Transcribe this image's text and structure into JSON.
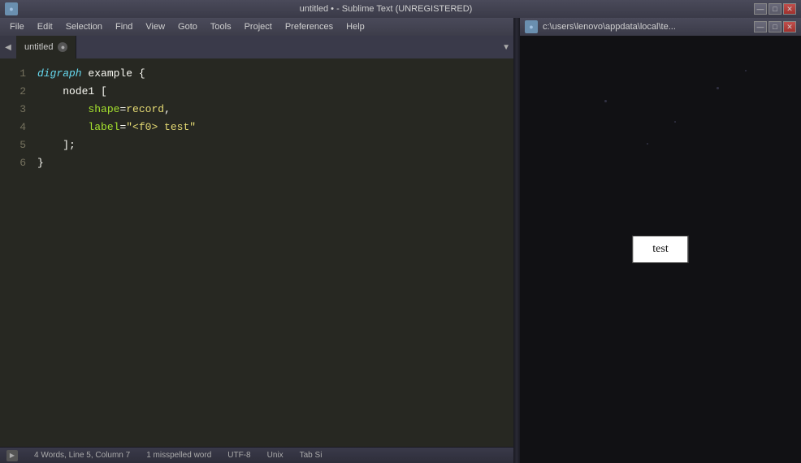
{
  "window": {
    "title": "untitled • - Sublime Text (UNREGISTERED)",
    "icon": "ST",
    "preview_title": "c:\\users\\lenovo\\appdata\\local\\te..."
  },
  "title_buttons": {
    "minimize": "—",
    "maximize": "□",
    "close": "✕"
  },
  "menu": {
    "items": [
      "File",
      "Edit",
      "Selection",
      "Find",
      "View",
      "Goto",
      "Tools",
      "Project",
      "Preferences",
      "Help"
    ]
  },
  "tab": {
    "name": "untitled",
    "close_btn": "●"
  },
  "code": {
    "lines": [
      {
        "num": "1",
        "content": "digraph example {"
      },
      {
        "num": "2",
        "content": "    node1 ["
      },
      {
        "num": "3",
        "content": "        shape=record,"
      },
      {
        "num": "4",
        "content": "        label=\"<f0> test\""
      },
      {
        "num": "5",
        "content": "    ];"
      },
      {
        "num": "6",
        "content": "}"
      }
    ]
  },
  "status_bar": {
    "words": "4 Words, Line 5, Column 7",
    "spelling": "1 misspelled word",
    "encoding": "UTF-8",
    "line_ending": "Unix",
    "tab": "Tab Si"
  },
  "graph": {
    "node_label": "test"
  }
}
